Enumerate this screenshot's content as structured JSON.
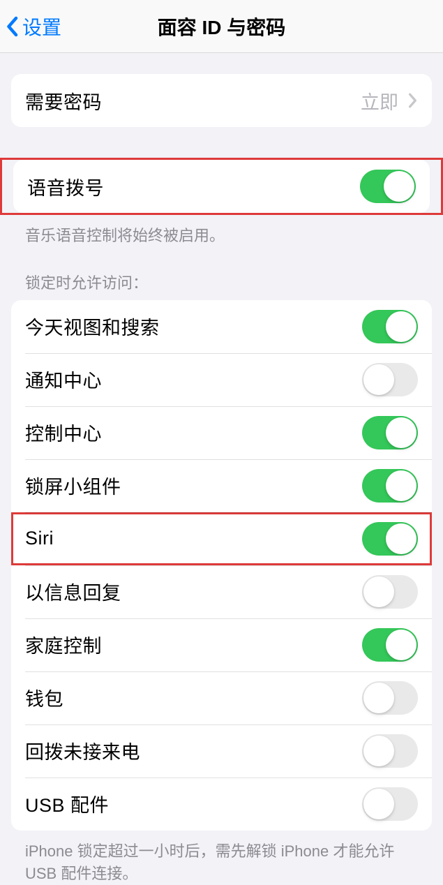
{
  "nav": {
    "back_label": "设置",
    "title": "面容 ID 与密码"
  },
  "passcode_section": {
    "require_passcode_label": "需要密码",
    "require_passcode_value": "立即"
  },
  "voice_dial": {
    "label": "语音拨号",
    "footer": "音乐语音控制将始终被启用。"
  },
  "locked_access": {
    "header": "锁定时允许访问：",
    "items": [
      {
        "label": "今天视图和搜索",
        "on": true
      },
      {
        "label": "通知中心",
        "on": false
      },
      {
        "label": "控制中心",
        "on": true
      },
      {
        "label": "锁屏小组件",
        "on": true
      },
      {
        "label": "Siri",
        "on": true
      },
      {
        "label": "以信息回复",
        "on": false
      },
      {
        "label": "家庭控制",
        "on": true
      },
      {
        "label": "钱包",
        "on": false
      },
      {
        "label": "回拨未接来电",
        "on": false
      },
      {
        "label": "USB 配件",
        "on": false
      }
    ],
    "footer": "iPhone 锁定超过一小时后，需先解锁 iPhone 才能允许USB 配件连接。"
  }
}
